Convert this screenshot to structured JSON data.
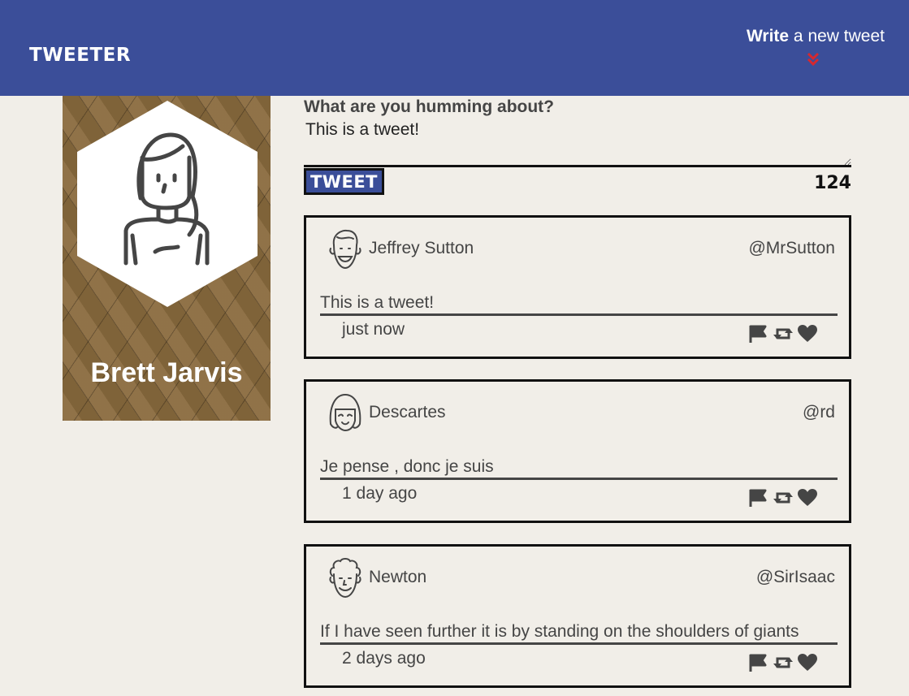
{
  "nav": {
    "brand": "Tweeter",
    "compose_bold": "Write",
    "compose_rest": " a new tweet",
    "chevron_color": "#d6282f"
  },
  "profile": {
    "name": "Brett Jarvis"
  },
  "compose": {
    "label": "What are you humming about?",
    "value": "This is a tweet!",
    "button": "TWEET",
    "counter": "124"
  },
  "tweets": [
    {
      "author": "Jeffrey Sutton",
      "handle": "@MrSutton",
      "text": "This is a tweet!",
      "time": "just now",
      "avatar": "smiling-man-avatar"
    },
    {
      "author": "Descartes",
      "handle": "@rd",
      "text": "Je pense , donc je suis",
      "time": "1 day ago",
      "avatar": "bob-hair-woman-avatar"
    },
    {
      "author": "Newton",
      "handle": "@SirIsaac",
      "text": "If I have seen further it is by standing on the shoulders of giants",
      "time": "2 days ago",
      "avatar": "curly-hair-man-avatar"
    }
  ],
  "colors": {
    "nav_bg": "#3b4e99",
    "page_bg": "#f1eee8",
    "profile_bg": "#8a6b3e",
    "text": "#454545"
  }
}
